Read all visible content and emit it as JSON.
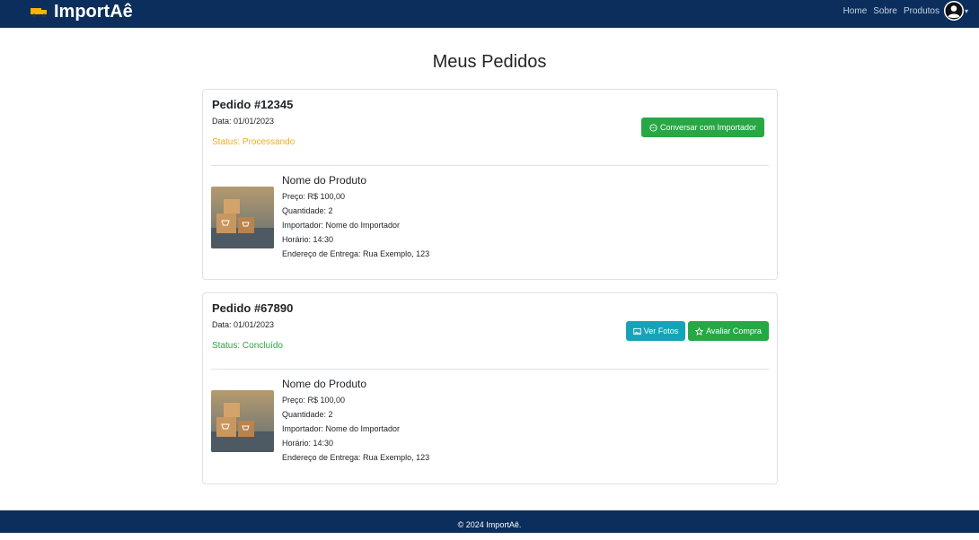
{
  "header": {
    "brand": "ImportAê",
    "nav": [
      "Home",
      "Sobre",
      "Produtos"
    ]
  },
  "page_title": "Meus Pedidos",
  "orders": [
    {
      "id": "Pedido #12345",
      "date": "Data: 01/01/2023",
      "status": "Status: Processando",
      "actions": [
        "Conversar com Importador"
      ],
      "product": {
        "name": "Nome do Produto",
        "price": "Preço: R$ 100,00",
        "quantity": "Quantidade: 2",
        "importer": "Importador: Nome do Importador",
        "time": "Horário: 14:30",
        "address": "Endereço de Entrega: Rua Exemplo, 123"
      }
    },
    {
      "id": "Pedido #67890",
      "date": "Data: 01/01/2023",
      "status": "Status: Concluído",
      "actions": [
        "Ver Fotos",
        "Avaliar Compra"
      ],
      "product": {
        "name": "Nome do Produto",
        "price": "Preço: R$ 100,00",
        "quantity": "Quantidade: 2",
        "importer": "Importador: Nome do Importador",
        "time": "Horário: 14:30",
        "address": "Endereço de Entrega: Rua Exemplo, 123"
      }
    }
  ],
  "footer": "© 2024 ImportAê.",
  "colors": {
    "navbar": "#0b2e5c",
    "status_processing": "#f0ad1f",
    "status_done": "#28a745",
    "button_green": "#28a745",
    "button_teal": "#17a2b8"
  },
  "icons": [
    "truck-logo-icon",
    "user-avatar-icon",
    "chat-icon",
    "image-icon",
    "star-icon"
  ]
}
